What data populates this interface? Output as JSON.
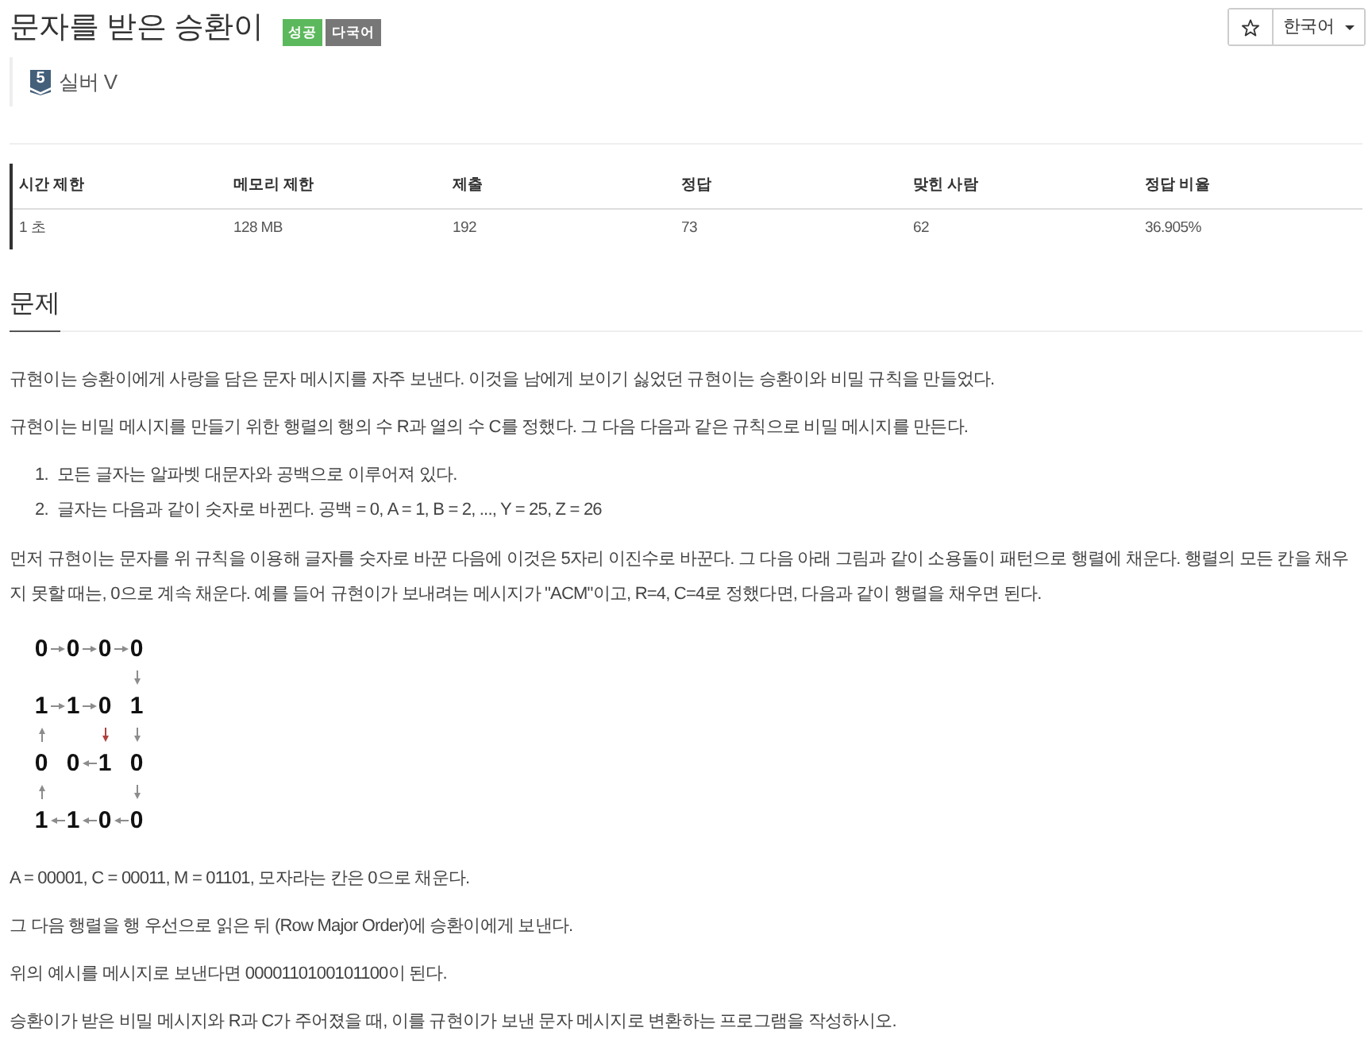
{
  "title": "문자를 받은 승환이",
  "badges": [
    {
      "text": "성공",
      "color": "#5cb85c"
    },
    {
      "text": "다국어",
      "color": "#777777"
    }
  ],
  "tier": {
    "level": "5",
    "name": "실버 V"
  },
  "language": {
    "value": "한국어"
  },
  "stats_table": {
    "columns": [
      "시간 제한",
      "메모리 제한",
      "제출",
      "정답",
      "맞힌 사람",
      "정답 비율"
    ],
    "rows": [
      [
        "1 초",
        "128 MB",
        "192",
        "73",
        "62",
        "36.905%"
      ]
    ]
  },
  "problem": {
    "heading": "문제",
    "blocks": [
      {
        "kind": "paragraph",
        "text": "규현이는 승환이에게 사랑을 담은 문자 메시지를 자주 보낸다. 이것을 남에게 보이기 싫었던 규현이는 승환이와 비밀 규칙을 만들었다."
      },
      {
        "kind": "paragraph",
        "text": "규현이는 비밀 메시지를 만들기 위한 행렬의 행의 수 R과 열의 수 C를 정했다. 그 다음 다음과 같은 규칙으로 비밀 메시지를 만든다."
      },
      {
        "kind": "ordered_list",
        "items": [
          {
            "marker": "1.",
            "text": "모든 글자는 알파벳 대문자와 공백으로 이루어져 있다."
          },
          {
            "marker": "2.",
            "text": "글자는 다음과 같이 숫자로 바뀐다. 공백 = 0, A = 1, B = 2, ..., Y = 25, Z = 26"
          }
        ]
      },
      {
        "kind": "paragraph",
        "text": "먼저 규현이는 문자를 위 규칙을 이용해 글자를 숫자로 바꾼 다음에 이것은 5자리 이진수로 바꾼다. 그 다음 아래 그림과 같이 소용돌이 패턴으로 행렬에 채운다. 행렬의 모든 칸을 채우지 못할 때는, 0으로 계속 채운다. 예를 들어 규현이가 보내려는 메시지가 \"ACM\"이고, R=4, C=4로 정했다면, 다음과 같이 행렬을 채우면 된다."
      },
      {
        "kind": "figure",
        "grid": [
          [
            {
              "kind": "digit",
              "text": "0"
            },
            {
              "kind": "arrow_right",
              "color": "#8c8c8c"
            },
            {
              "kind": "digit",
              "text": "0"
            },
            {
              "kind": "arrow_right",
              "color": "#8c8c8c"
            },
            {
              "kind": "digit",
              "text": "0"
            },
            {
              "kind": "arrow_right",
              "color": "#8c8c8c"
            },
            {
              "kind": "digit",
              "text": "0"
            }
          ],
          [
            {
              "kind": "blank"
            },
            {
              "kind": "blank"
            },
            {
              "kind": "blank"
            },
            {
              "kind": "blank"
            },
            {
              "kind": "blank"
            },
            {
              "kind": "blank"
            },
            {
              "kind": "arrow_down",
              "color": "#8c8c8c"
            }
          ],
          [
            {
              "kind": "digit",
              "text": "1"
            },
            {
              "kind": "arrow_right",
              "color": "#8c8c8c"
            },
            {
              "kind": "digit",
              "text": "1"
            },
            {
              "kind": "arrow_right",
              "color": "#8c8c8c"
            },
            {
              "kind": "digit",
              "text": "0"
            },
            {
              "kind": "blank"
            },
            {
              "kind": "digit",
              "text": "1"
            }
          ],
          [
            {
              "kind": "arrow_up",
              "color": "#8c8c8c"
            },
            {
              "kind": "blank"
            },
            {
              "kind": "blank"
            },
            {
              "kind": "blank"
            },
            {
              "kind": "arrow_down",
              "color": "#b0413e"
            },
            {
              "kind": "blank"
            },
            {
              "kind": "arrow_down",
              "color": "#8c8c8c"
            }
          ],
          [
            {
              "kind": "digit",
              "text": "0"
            },
            {
              "kind": "blank"
            },
            {
              "kind": "digit",
              "text": "0"
            },
            {
              "kind": "arrow_left",
              "color": "#8c8c8c"
            },
            {
              "kind": "digit",
              "text": "1"
            },
            {
              "kind": "blank"
            },
            {
              "kind": "digit",
              "text": "0"
            }
          ],
          [
            {
              "kind": "arrow_up",
              "color": "#8c8c8c"
            },
            {
              "kind": "blank"
            },
            {
              "kind": "blank"
            },
            {
              "kind": "blank"
            },
            {
              "kind": "blank"
            },
            {
              "kind": "blank"
            },
            {
              "kind": "arrow_down",
              "color": "#8c8c8c"
            }
          ],
          [
            {
              "kind": "digit",
              "text": "1"
            },
            {
              "kind": "arrow_left",
              "color": "#8c8c8c"
            },
            {
              "kind": "digit",
              "text": "1"
            },
            {
              "kind": "arrow_left",
              "color": "#8c8c8c"
            },
            {
              "kind": "digit",
              "text": "0"
            },
            {
              "kind": "arrow_left",
              "color": "#8c8c8c"
            },
            {
              "kind": "digit",
              "text": "0"
            }
          ]
        ]
      },
      {
        "kind": "paragraph",
        "text": "A = 00001, C = 00011, M = 01101, 모자라는 칸은 0으로 채운다."
      },
      {
        "kind": "paragraph",
        "text": "그 다음 행렬을 행 우선으로 읽은 뒤 (Row Major Order)에 승환이에게 보낸다."
      },
      {
        "kind": "paragraph",
        "text": "위의 예시를 메시지로 보낸다면 0000110100101100이 된다."
      },
      {
        "kind": "paragraph",
        "text": "승환이가 받은 비밀 메시지와 R과 C가 주어졌을 때, 이를 규현이가 보낸 문자 메시지로 변환하는 프로그램을 작성하시오."
      }
    ]
  }
}
